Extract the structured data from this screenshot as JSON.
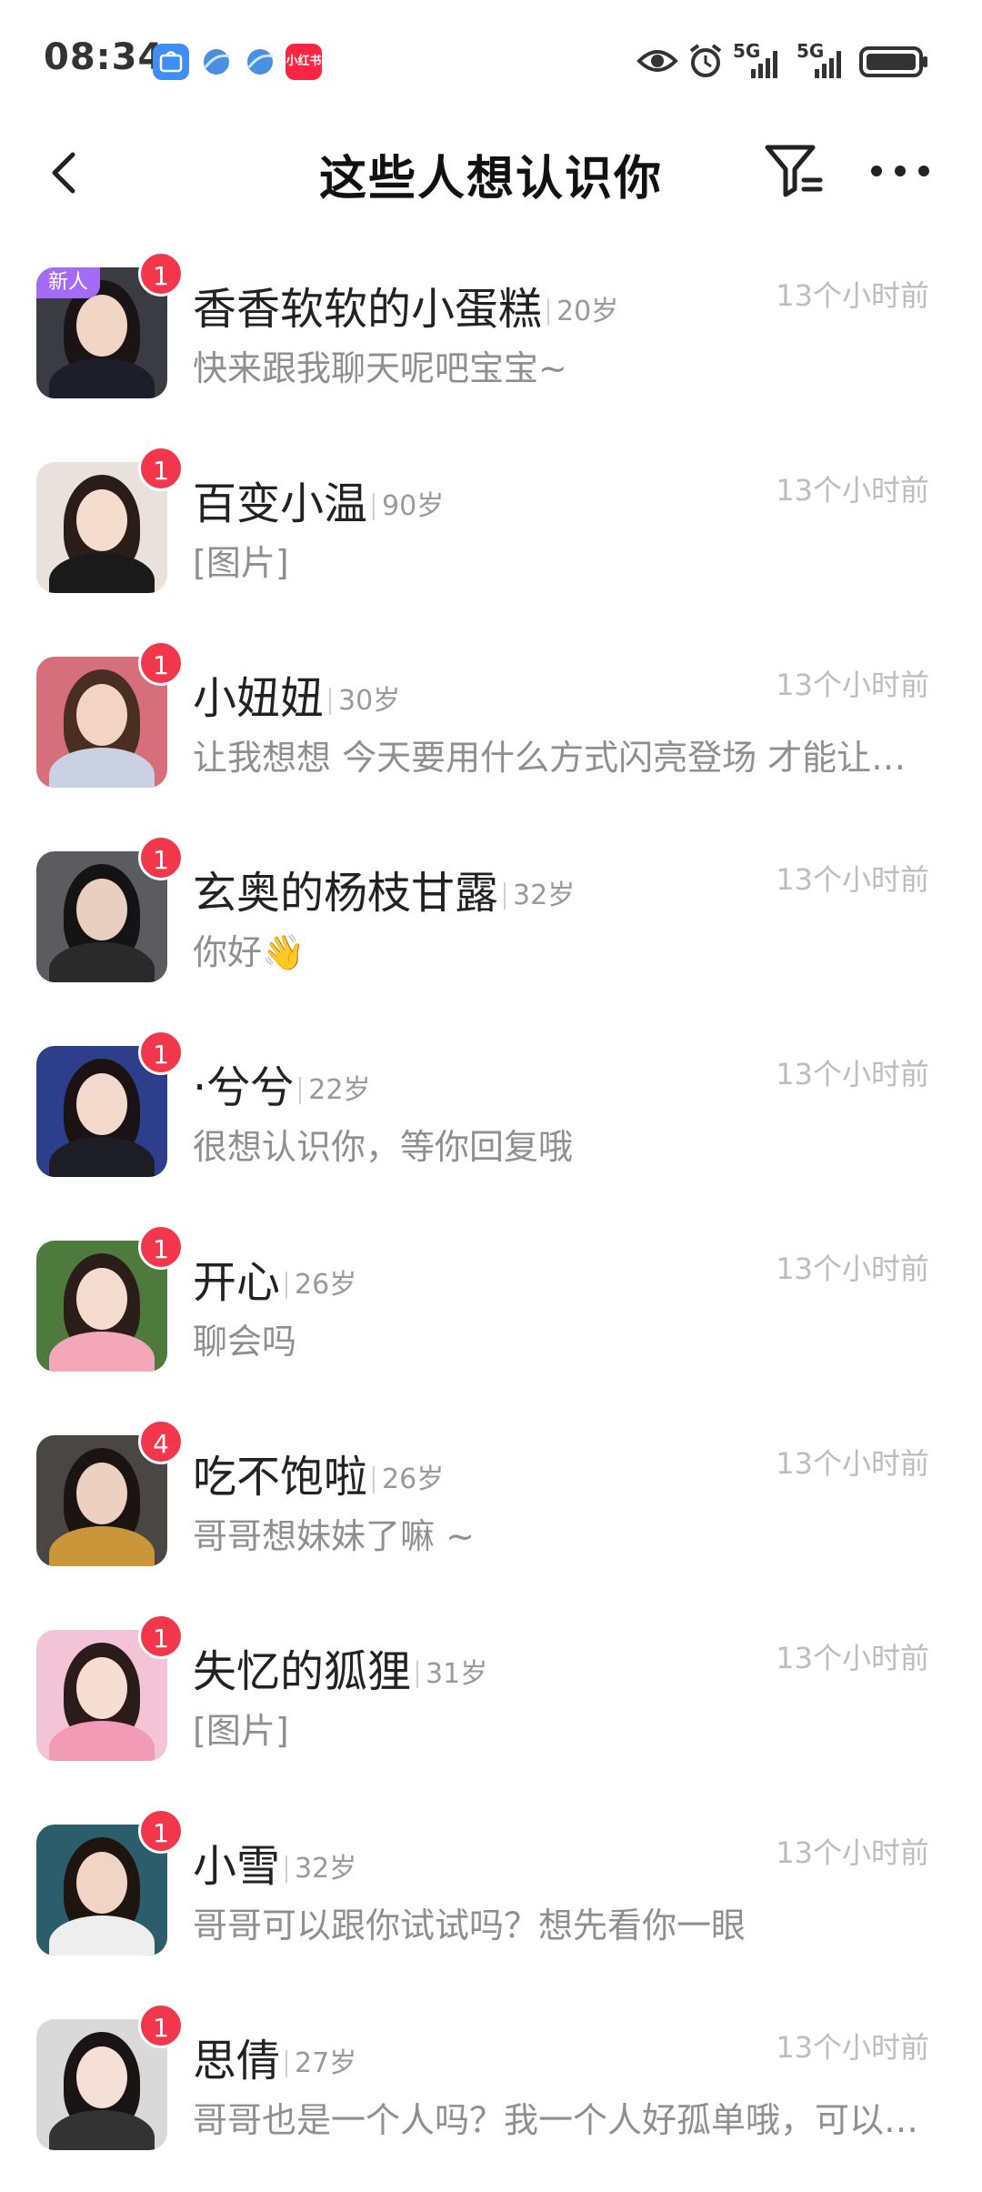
{
  "status_bar": {
    "time": "08:34",
    "signal_label_1": "5G",
    "signal_label_2": "5G",
    "apps": [
      {
        "name": "honor-app-icon",
        "color": "#3d8ef7",
        "text": "HONOR"
      },
      {
        "name": "browser-app-icon",
        "color": "#4a90e2",
        "text": ""
      },
      {
        "name": "browser-app-icon-2",
        "color": "#4a90e2",
        "text": ""
      },
      {
        "name": "xiaohongshu-app-icon",
        "color": "#ff2442",
        "text": "小红书"
      }
    ]
  },
  "header": {
    "title": "这些人想认识你"
  },
  "list": [
    {
      "name": "香香软软的小蛋糕",
      "age": "20岁",
      "time": "13个小时前",
      "message": "快来跟我聊天呢吧宝宝~",
      "badge": "1",
      "new_tag": "新人",
      "avatar_bg": "#3b3b44",
      "skin": "#f1d6c6",
      "hair": "#1b1416",
      "cloth": "#1e1e2a"
    },
    {
      "name": "百变小温",
      "age": "90岁",
      "time": "13个小时前",
      "message": "[图片]",
      "badge": "1",
      "new_tag": "",
      "avatar_bg": "#e9e2dc",
      "skin": "#f4dccf",
      "hair": "#2a1c17",
      "cloth": "#1a1a1a"
    },
    {
      "name": "小妞妞",
      "age": "30岁",
      "time": "13个小时前",
      "message": "让我想想 今天要用什么方式闪亮登场 才能让你一眼就记住我",
      "badge": "1",
      "new_tag": "",
      "avatar_bg": "#d46f7b",
      "skin": "#f3d3c1",
      "hair": "#4a2e22",
      "cloth": "#c9d1e3"
    },
    {
      "name": "玄奥的杨枝甘露",
      "age": "32岁",
      "time": "13个小时前",
      "message": "你好👋",
      "badge": "1",
      "new_tag": "",
      "avatar_bg": "#5b5b60",
      "skin": "#e9cfc0",
      "hair": "#141414",
      "cloth": "#2a2a2a"
    },
    {
      "name": "·兮兮",
      "age": "22岁",
      "time": "13个小时前",
      "message": "很想认识你，等你回复哦",
      "badge": "1",
      "new_tag": "",
      "avatar_bg": "#2d3e8a",
      "skin": "#f2d9cc",
      "hair": "#1a1215",
      "cloth": "#1d1d26"
    },
    {
      "name": "开心",
      "age": "26岁",
      "time": "13个小时前",
      "message": "聊会吗",
      "badge": "1",
      "new_tag": "",
      "avatar_bg": "#4f7a3e",
      "skin": "#f4dbcf",
      "hair": "#2b1d18",
      "cloth": "#f3a7b8"
    },
    {
      "name": "吃不饱啦",
      "age": "26岁",
      "time": "13个小时前",
      "message": "哥哥想妹妹了嘛 ~",
      "badge": "4",
      "new_tag": "",
      "avatar_bg": "#4a4644",
      "skin": "#ecd0c0",
      "hair": "#1b1412",
      "cloth": "#c9963a"
    },
    {
      "name": "失忆的狐狸",
      "age": "31岁",
      "time": "13个小时前",
      "message": "[图片]",
      "badge": "1",
      "new_tag": "",
      "avatar_bg": "#f3c3d6",
      "skin": "#f6ded3",
      "hair": "#2b1b1b",
      "cloth": "#f29bb7"
    },
    {
      "name": "小雪",
      "age": "32岁",
      "time": "13个小时前",
      "message": "哥哥可以跟你试试吗？想先看你一眼",
      "badge": "1",
      "new_tag": "",
      "avatar_bg": "#2c5d6b",
      "skin": "#f1d5c4",
      "hair": "#1e1410",
      "cloth": "#eeeeee"
    },
    {
      "name": "思倩",
      "age": "27岁",
      "time": "13个小时前",
      "message": "哥哥也是一个人吗？我一个人好孤单哦，可以陪我聊聊天吗",
      "badge": "1",
      "new_tag": "",
      "avatar_bg": "#d9d9d9",
      "skin": "#f4e0d6",
      "hair": "#1a1414",
      "cloth": "#333333"
    }
  ]
}
